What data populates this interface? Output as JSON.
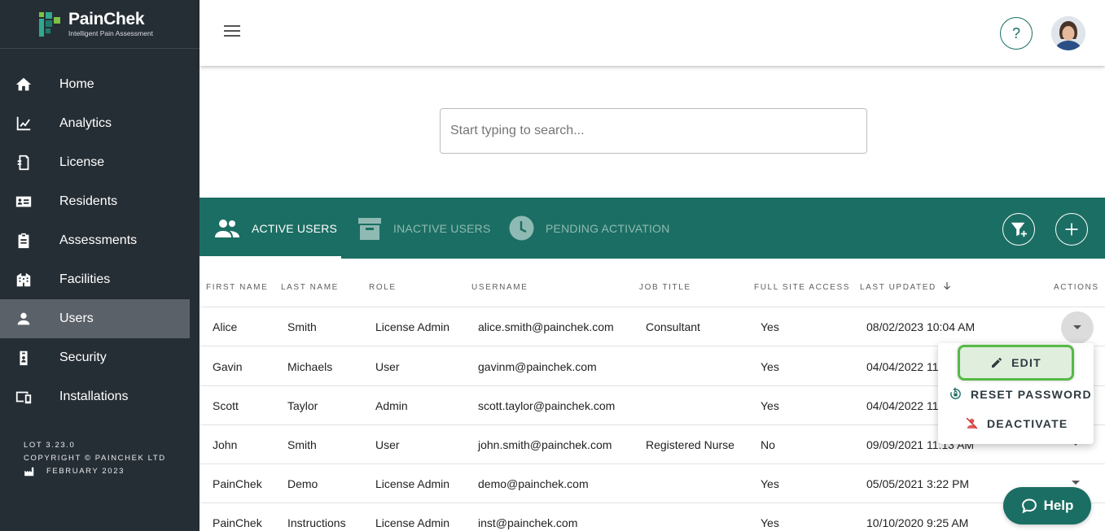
{
  "brand": {
    "name": "PainChek",
    "tagline": "Intelligent Pain Assessment"
  },
  "sidebar": {
    "items": [
      {
        "label": "Home",
        "icon": "home-icon"
      },
      {
        "label": "Analytics",
        "icon": "analytics-icon"
      },
      {
        "label": "License",
        "icon": "license-icon"
      },
      {
        "label": "Residents",
        "icon": "residents-icon"
      },
      {
        "label": "Assessments",
        "icon": "assessments-icon"
      },
      {
        "label": "Facilities",
        "icon": "facilities-icon"
      },
      {
        "label": "Users",
        "icon": "user-icon",
        "active": true
      },
      {
        "label": "Security",
        "icon": "security-icon"
      },
      {
        "label": "Installations",
        "icon": "installations-icon"
      }
    ],
    "footer": {
      "version": "LOT 3.23.0",
      "copyright": "COPYRIGHT © PAINCHEK LTD",
      "date": "FEBRUARY 2023"
    }
  },
  "topbar": {
    "help_symbol": "?"
  },
  "search": {
    "placeholder": "Start typing to search...",
    "value": ""
  },
  "tabs": [
    {
      "label": "ACTIVE USERS",
      "active": true
    },
    {
      "label": "INACTIVE USERS",
      "active": false
    },
    {
      "label": "PENDING ACTIVATION",
      "active": false
    }
  ],
  "table": {
    "columns": [
      "FIRST NAME",
      "LAST NAME",
      "ROLE",
      "USERNAME",
      "JOB TITLE",
      "FULL SITE ACCESS",
      "LAST UPDATED",
      "ACTIONS"
    ],
    "rows": [
      {
        "first": "Alice",
        "last": "Smith",
        "role": "License Admin",
        "username": "alice.smith@painchek.com",
        "job": "Consultant",
        "access": "Yes",
        "updated": "08/02/2023 10:04 AM"
      },
      {
        "first": "Gavin",
        "last": "Michaels",
        "role": "User",
        "username": "gavinm@painchek.com",
        "job": "",
        "access": "Yes",
        "updated": "04/04/2022 11"
      },
      {
        "first": "Scott",
        "last": "Taylor",
        "role": "Admin",
        "username": "scott.taylor@painchek.com",
        "job": "",
        "access": "Yes",
        "updated": "04/04/2022 11"
      },
      {
        "first": "John",
        "last": "Smith",
        "role": "User",
        "username": "john.smith@painchek.com",
        "job": "Registered Nurse",
        "access": "No",
        "updated": "09/09/2021 11:13 AM"
      },
      {
        "first": "PainChek",
        "last": "Demo",
        "role": "License Admin",
        "username": "demo@painchek.com",
        "job": "",
        "access": "Yes",
        "updated": "05/05/2021 3:22 PM"
      },
      {
        "first": "PainChek",
        "last": "Instructions",
        "role": "License Admin",
        "username": "inst@painchek.com",
        "job": "",
        "access": "Yes",
        "updated": "10/10/2020 9:25 AM"
      }
    ]
  },
  "actions_menu": {
    "edit": "EDIT",
    "reset": "RESET PASSWORD",
    "deactivate": "DEACTIVATE"
  },
  "help_button": {
    "label": "Help"
  },
  "colors": {
    "sidebar": "#262e35",
    "accent": "#1b6e63",
    "highlight": "#56b946"
  }
}
